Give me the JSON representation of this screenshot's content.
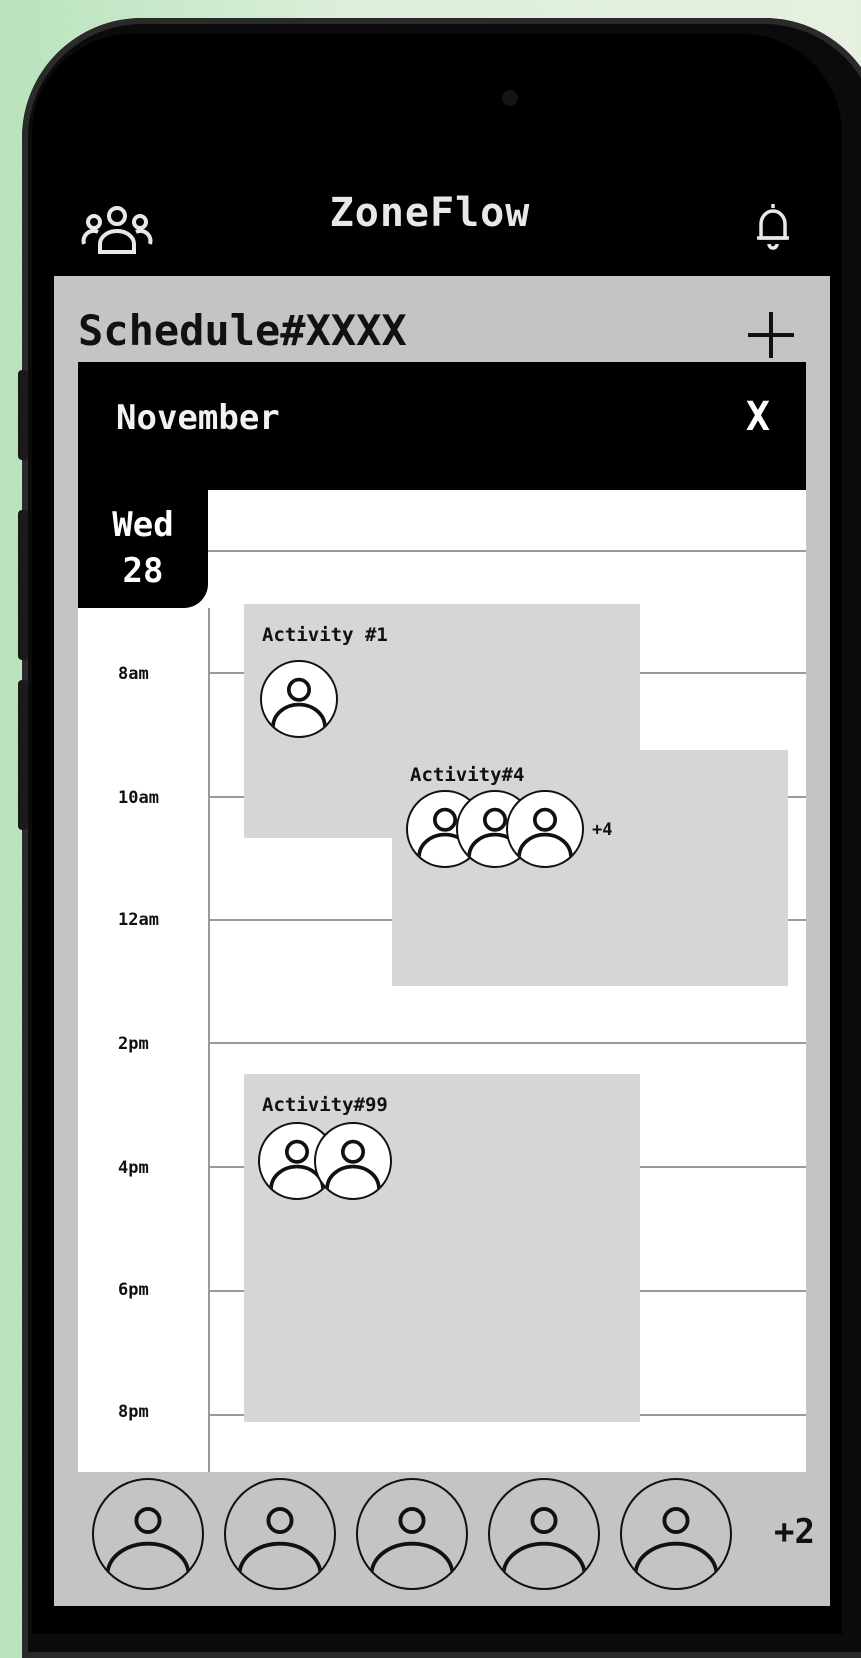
{
  "app": {
    "title": "ZoneFlow"
  },
  "header": {
    "left_icon": "people-group-icon",
    "right_icon": "bell-icon"
  },
  "schedule": {
    "title": "Schedule#XXXX",
    "add_icon": "plus-icon"
  },
  "calendar": {
    "month": "November",
    "close_label": "X",
    "day": {
      "weekday": "Wed",
      "date": "28"
    },
    "times": [
      "8am",
      "10am",
      "12am",
      "2pm",
      "4pm",
      "6pm",
      "8pm"
    ],
    "activities": [
      {
        "title": "Activity #1",
        "attendees_shown": 1
      },
      {
        "title": "Activity#4",
        "attendees_shown": 3,
        "more": "+4"
      },
      {
        "title": "Activity#99",
        "attendees_shown": 2
      }
    ]
  },
  "participants": {
    "shown": 5,
    "more": "+2"
  },
  "colors": {
    "panel": "#c4c4c4",
    "activity": "#d6d6d6",
    "header": "#000000",
    "accent_bg": "#b9e3bd"
  }
}
